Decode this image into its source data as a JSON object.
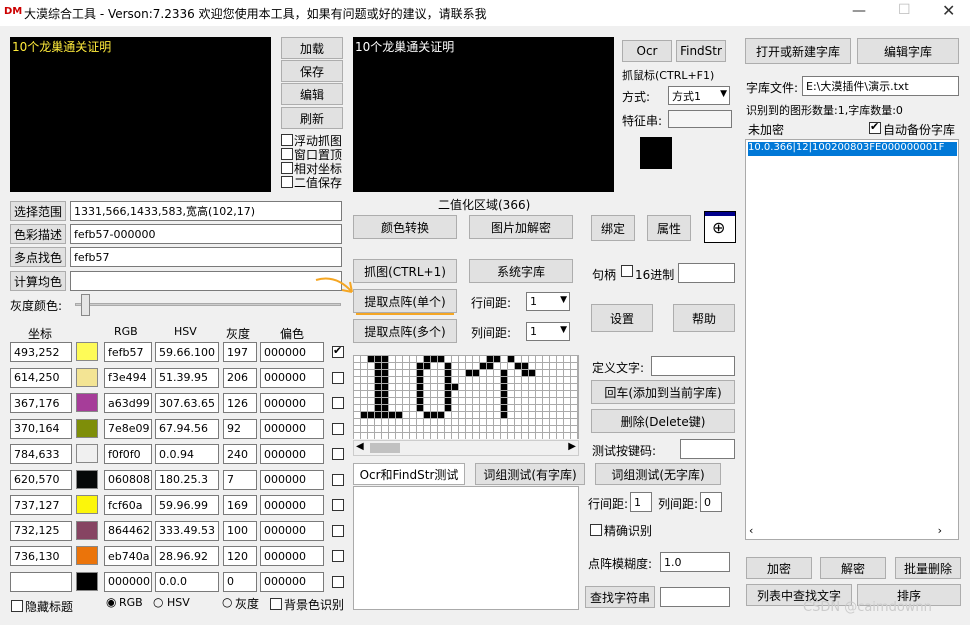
{
  "window": {
    "logo": "DM",
    "title": "大漠综合工具 - Verson:7.2336 欢迎您使用本工具，如果有问题或好的建议，请联系我"
  },
  "preview": {
    "left_caption": "10个龙巢通关证明",
    "right_caption": "10个龙巢通关证明"
  },
  "mid_buttons": [
    "加载",
    "保存",
    "编辑",
    "刷新"
  ],
  "options": [
    {
      "label": "浮动抓图",
      "checked": false
    },
    {
      "label": "窗口置顶",
      "checked": false
    },
    {
      "label": "相对坐标",
      "checked": false
    },
    {
      "label": "二值保存",
      "checked": false
    }
  ],
  "left_rows": [
    {
      "button": "选择范围",
      "value": "1331,566,1433,583,宽高(102,17)"
    },
    {
      "button": "色彩描述",
      "value": "fefb57-000000"
    },
    {
      "button": "多点找色",
      "value": "fefb57"
    },
    {
      "button": "计算均色",
      "value": ""
    }
  ],
  "gray": {
    "label": "灰度颜色:"
  },
  "color_table": {
    "headers": [
      "坐标",
      "RGB",
      "HSV",
      "灰度",
      "偏色"
    ],
    "rows": [
      {
        "coord": "493,252",
        "color": "#fefb57",
        "rgb": "fefb57",
        "hsv": "59.66.100",
        "gray": "197",
        "bias": "000000",
        "checked": true
      },
      {
        "coord": "614,250",
        "color": "#f3e494",
        "rgb": "f3e494",
        "hsv": "51.39.95",
        "gray": "206",
        "bias": "000000",
        "checked": false
      },
      {
        "coord": "367,176",
        "color": "#a63d99",
        "rgb": "a63d99",
        "hsv": "307.63.65",
        "gray": "126",
        "bias": "000000",
        "checked": false
      },
      {
        "coord": "370,164",
        "color": "#7e8e09",
        "rgb": "7e8e09",
        "hsv": "67.94.56",
        "gray": "92",
        "bias": "000000",
        "checked": false
      },
      {
        "coord": "784,633",
        "color": "#f0f0f0",
        "rgb": "f0f0f0",
        "hsv": "0.0.94",
        "gray": "240",
        "bias": "000000",
        "checked": false
      },
      {
        "coord": "620,570",
        "color": "#060808",
        "rgb": "060808",
        "hsv": "180.25.3",
        "gray": "7",
        "bias": "000000",
        "checked": false
      },
      {
        "coord": "737,127",
        "color": "#fcf60a",
        "rgb": "fcf60a",
        "hsv": "59.96.99",
        "gray": "169",
        "bias": "000000",
        "checked": false
      },
      {
        "coord": "732,125",
        "color": "#864462",
        "rgb": "864462",
        "hsv": "333.49.53",
        "gray": "100",
        "bias": "000000",
        "checked": false
      },
      {
        "coord": "736,130",
        "color": "#eb740a",
        "rgb": "eb740a",
        "hsv": "28.96.92",
        "gray": "120",
        "bias": "000000",
        "checked": false
      },
      {
        "coord": "",
        "color": "#000000",
        "rgb": "000000",
        "hsv": "0.0.0",
        "gray": "0",
        "bias": "000000",
        "checked": false
      }
    ]
  },
  "bottom": {
    "hide_title": "隐藏标题",
    "rgb": "RGB",
    "hsv": "HSV",
    "gray": "灰度",
    "bg": "背景色识别"
  },
  "binary": {
    "title": "二值化区域(366)",
    "color_convert": "颜色转换",
    "pic_decrypt": "图片加解密",
    "capture": "抓图(CTRL+1)",
    "sys_lib": "系统字库",
    "extract_single": "提取点阵(单个)",
    "extract_multi": "提取点阵(多个)",
    "row_gap": "行间距:",
    "col_gap": "列间距:",
    "row_val": "1",
    "col_val": "1"
  },
  "ocr": {
    "ocr_btn": "Ocr",
    "findstr_btn": "FindStr",
    "grab_mouse": "抓鼠标(CTRL+F1)",
    "mode_label": "方式:",
    "mode_value": "方式1",
    "feature": "特征串:",
    "bind": "绑定",
    "property": "属性"
  },
  "handle": {
    "label": "句柄",
    "hex": "16进制",
    "value": ""
  },
  "settings": {
    "settings": "设置",
    "help": "帮助",
    "define_text": "定义文字:",
    "enter_add": "回车(添加到当前字库)",
    "delete": "删除(Delete键)",
    "test_key": "测试按键码:"
  },
  "tabs": [
    "Ocr和FindStr测试",
    "词组测试(有字库)",
    "词组测试(无字库)"
  ],
  "test": {
    "row_gap": "行间距:",
    "row_val": "1",
    "col_gap": "列间距:",
    "col_val": "0",
    "exact": "精确识别",
    "fuzzy": "点阵模糊度:",
    "fuzzy_val": "1.0",
    "find_string": "查找字符串"
  },
  "lib": {
    "open_new": "打开或新建字库",
    "edit_lib": "编辑字库",
    "file_label": "字库文件:",
    "file_path": "E:\\大漠插件\\演示.txt",
    "stats": "识别到的图形数量:1,字库数量:0",
    "encrypt_state": "未加密",
    "auto_backup": "自动备份字库",
    "list_item": "10.0.366|12|100200803FE000000001F",
    "encrypt": "加密",
    "decrypt": "解密",
    "batch_delete": "批量删除",
    "list_find": "列表中查找文字",
    "sort": "排序"
  },
  "annotation_color": "#f5a623",
  "watermark": "CSDN @caimdownn",
  "dot_text": "10个"
}
